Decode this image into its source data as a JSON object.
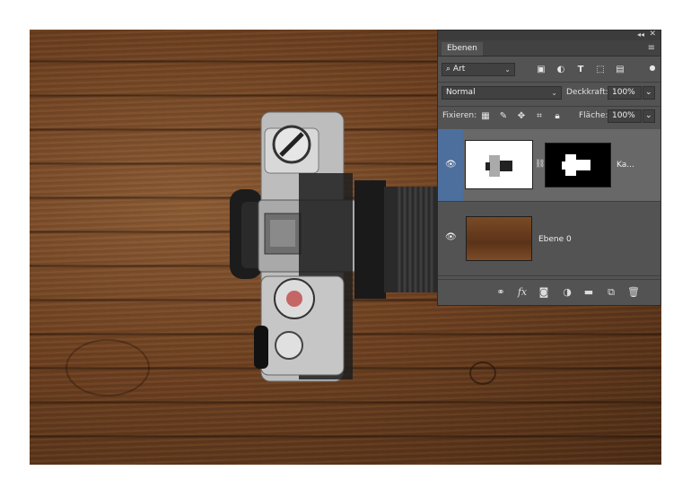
{
  "panel": {
    "tab_label": "Ebenen",
    "filter": {
      "value": "Art"
    },
    "blend_mode": "Normal",
    "opacity_label": "Deckkraft:",
    "opacity_value": "100%",
    "lock_label": "Fixieren:",
    "fill_label": "Fläche:",
    "fill_value": "100%",
    "layers": [
      {
        "name": "Ka...",
        "visible": true,
        "selected": true,
        "has_mask": true
      },
      {
        "name": "Ebene 0",
        "visible": true,
        "selected": false,
        "has_mask": false
      }
    ]
  },
  "colors": {
    "panel_bg": "#535353",
    "selected_layer": "#686868",
    "selected_eye_column": "#4d6f9e",
    "wood": "#6b3f20"
  },
  "icons": {
    "filter_types": [
      "image-filter-icon",
      "adjustment-filter-icon",
      "type-filter-icon",
      "shape-filter-icon",
      "smart-object-filter-icon"
    ],
    "lock": [
      "lock-transparent-pixels-icon",
      "lock-image-pixels-icon",
      "lock-position-icon",
      "lock-artboard-icon",
      "lock-all-icon"
    ],
    "footer": [
      "link-layers-icon",
      "fx-icon",
      "add-mask-icon",
      "adjustment-layer-icon",
      "new-group-icon",
      "new-layer-icon",
      "delete-layer-icon"
    ]
  }
}
